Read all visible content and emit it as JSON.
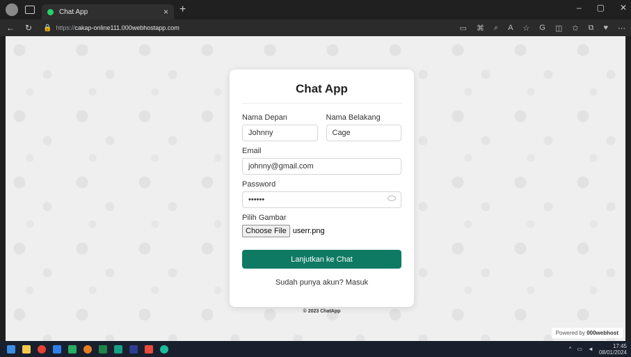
{
  "browser": {
    "tab_title": "Chat App",
    "tab_close": "×",
    "new_tab": "+",
    "url_scheme": "https://",
    "url_host": "cakap-online111.000webhostapp.com"
  },
  "card": {
    "title": "Chat App",
    "first_name_label": "Nama Depan",
    "first_name_value": "Johnny",
    "last_name_label": "Nama Belakang",
    "last_name_value": "Cage",
    "email_label": "Email",
    "email_value": "johnny@gmail.com",
    "password_label": "Password",
    "password_value": "••••••",
    "image_label": "Pilih Gambar",
    "choose_file_label": "Choose File",
    "file_name": "userr.png",
    "submit_label": "Lanjutkan ke Chat",
    "signin_prompt": "Sudah punya akun?",
    "signin_link": "Masuk",
    "footer": "© 2023 ChatApp"
  },
  "powered_by": {
    "prefix": "Powered by",
    "brand": "000webhost"
  },
  "taskbar": {
    "time": "17:45",
    "date": "08/01/2024"
  },
  "colors": {
    "accent": "#0f7a64"
  }
}
